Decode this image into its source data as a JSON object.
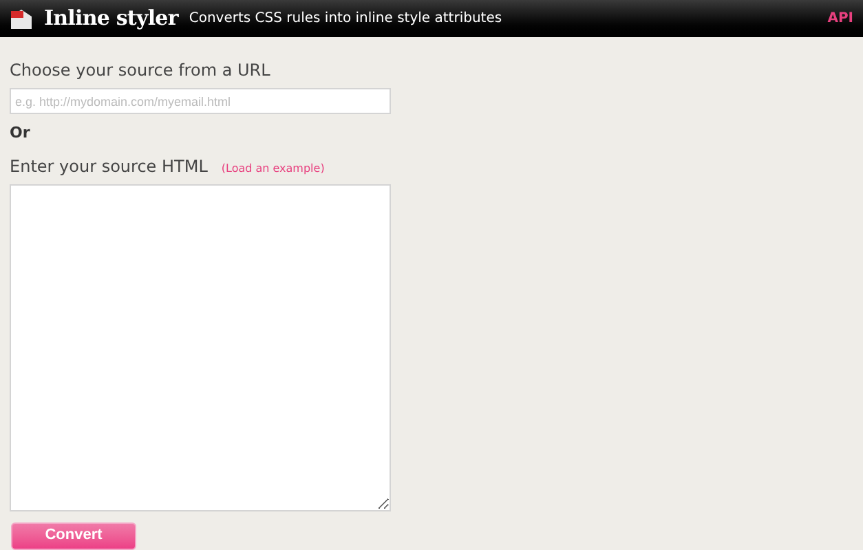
{
  "header": {
    "title": "Inline styler",
    "tagline": "Converts CSS rules into inline style attributes",
    "api_link": "API"
  },
  "url_section": {
    "label": "Choose your source from a URL",
    "placeholder": "e.g. http://mydomain.com/myemail.html"
  },
  "separator": "Or",
  "html_section": {
    "label": "Enter your source HTML",
    "example_link": "(Load an example)"
  },
  "convert_button": "Convert"
}
